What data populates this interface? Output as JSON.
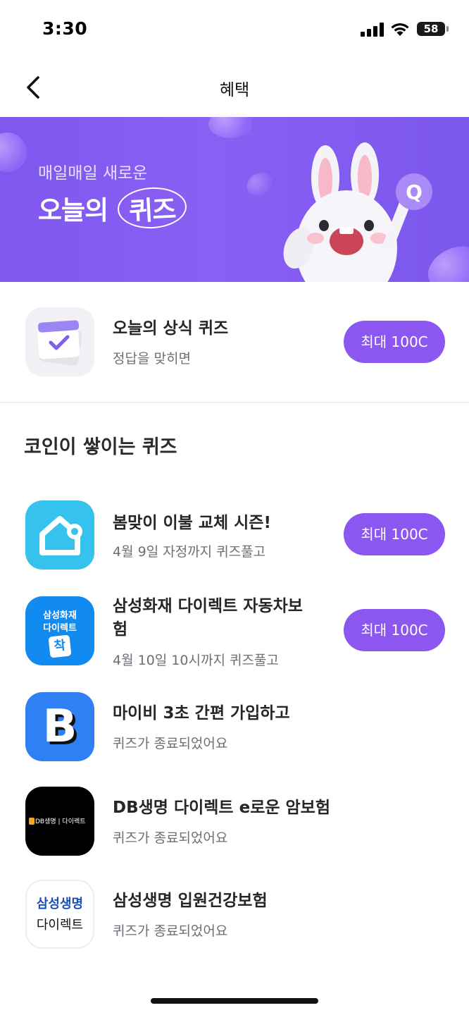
{
  "status_bar": {
    "time": "3:30",
    "battery": "58"
  },
  "nav": {
    "title": "혜택"
  },
  "banner": {
    "subtitle": "매일매일 새로운",
    "title_prefix": "오늘의 ",
    "title_highlight": "퀴즈",
    "accent_color": "#8a5ff4"
  },
  "featured": {
    "title": "오늘의 상식 퀴즈",
    "subtitle": "정답을 맞히면",
    "reward": "최대 100C"
  },
  "section": {
    "title": "코인이 쌓이는 퀴즈"
  },
  "quizzes": [
    {
      "icon": "house-icon",
      "title": "봄맞이 이불 교체 시즌!",
      "subtitle": "4월 9일 자정까지 퀴즈풀고",
      "reward": "최대 100C"
    },
    {
      "icon": "samsung-fire-direct-logo",
      "logo_line1": "삼성화재",
      "logo_line2": "다이렉트",
      "logo_badge": "착",
      "title_line1": "삼성화재 다이렉트 자동차보",
      "title_line2": "험",
      "subtitle": "4월 10일 10시까지 퀴즈풀고",
      "reward": "최대 100C"
    },
    {
      "icon": "mybee-logo",
      "logo_letter": "B",
      "title": "마이비 3초 간편 가입하고",
      "subtitle": "퀴즈가 종료되었어요"
    },
    {
      "icon": "db-life-logo",
      "logo_text": "DB생명 | 다이렉트",
      "title": "DB생명 다이렉트 e로운 암보험",
      "subtitle": "퀴즈가 종료되었어요"
    },
    {
      "icon": "samsung-life-direct-logo",
      "logo_line1": "삼성생명",
      "logo_line2": "다이렉트",
      "title": "삼성생명 입원건강보험",
      "subtitle": "퀴즈가 종료되었어요"
    }
  ],
  "colors": {
    "reward_button": "#8b57f0",
    "house_icon_bg": "#35c3ee",
    "samsung_fire_bg": "#118bf0",
    "mybee_bg": "#2f80f5",
    "db_bg": "#000000"
  }
}
